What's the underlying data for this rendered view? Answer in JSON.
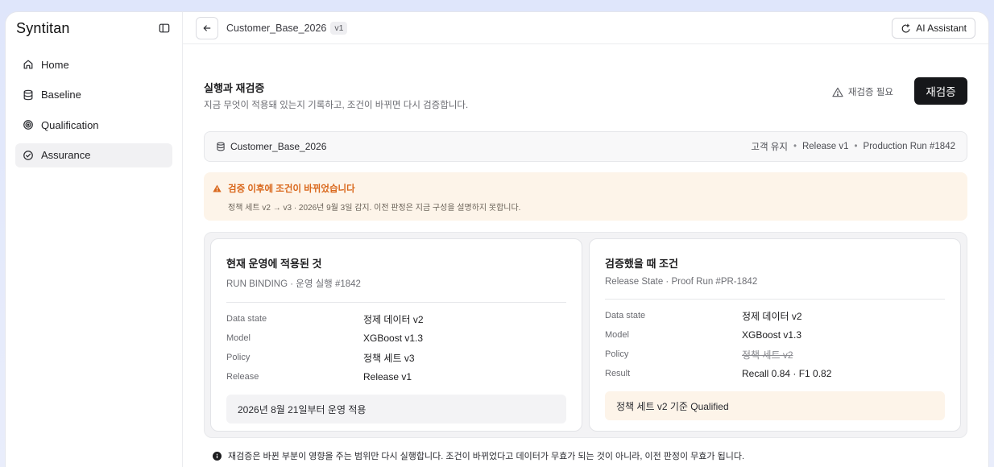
{
  "app": {
    "brand": "Syntitan"
  },
  "sidebar": {
    "items": [
      {
        "label": "Home",
        "icon": "home-icon"
      },
      {
        "label": "Baseline",
        "icon": "database-icon"
      },
      {
        "label": "Qualification",
        "icon": "target-icon"
      },
      {
        "label": "Assurance",
        "icon": "check-circle-icon",
        "active": true
      }
    ]
  },
  "topbar": {
    "breadcrumb": "Customer_Base_2026",
    "version": "v1",
    "ai_button": "AI Assistant"
  },
  "header": {
    "title": "실행과 재검증",
    "subtitle": "지금 무엇이 적용돼 있는지 기록하고, 조건이 바뀌면 다시 검증합니다.",
    "warning": "재검증 필요",
    "action": "재검증"
  },
  "dataset": {
    "name": "Customer_Base_2026",
    "tags": [
      "고객 유지",
      "Release v1",
      "Production Run #1842"
    ]
  },
  "alert": {
    "title": "검증 이후에 조건이 바뀌었습니다",
    "body": "정책 세트 v2 → v3 · 2026년 9월 3일 감지. 이전 판정은 지금 구성을 설명하지 못합니다.",
    "color": "#d9671b"
  },
  "cards": {
    "current": {
      "title": "현재 운영에 적용된 것",
      "subtitle": "RUN BINDING · 운영 실행 #1842",
      "rows": [
        {
          "key": "Data state",
          "value": "정제 데이터 v2"
        },
        {
          "key": "Model",
          "value": "XGBoost v1.3"
        },
        {
          "key": "Policy",
          "value": "정책 세트 v3"
        },
        {
          "key": "Release",
          "value": "Release v1"
        }
      ],
      "note": "2026년 8월 21일부터 운영 적용"
    },
    "validated": {
      "title": "검증했을 때 조건",
      "subtitle": "Release State · Proof Run #PR-1842",
      "rows": [
        {
          "key": "Data state",
          "value": "정제 데이터 v2"
        },
        {
          "key": "Model",
          "value": "XGBoost v1.3"
        },
        {
          "key": "Policy",
          "value": "정책 세트 v2"
        },
        {
          "key": "Result",
          "value": "Recall 0.84 · F1 0.82"
        }
      ],
      "note": "정책 세트 v2 기준 Qualified"
    }
  },
  "footer": {
    "note": "재검증은 바뀐 부분이 영향을 주는 범위만 다시 실행합니다. 조건이 바뀌었다고 데이터가 무효가 되는 것이 아니라, 이전 판정이 무효가 됩니다."
  }
}
